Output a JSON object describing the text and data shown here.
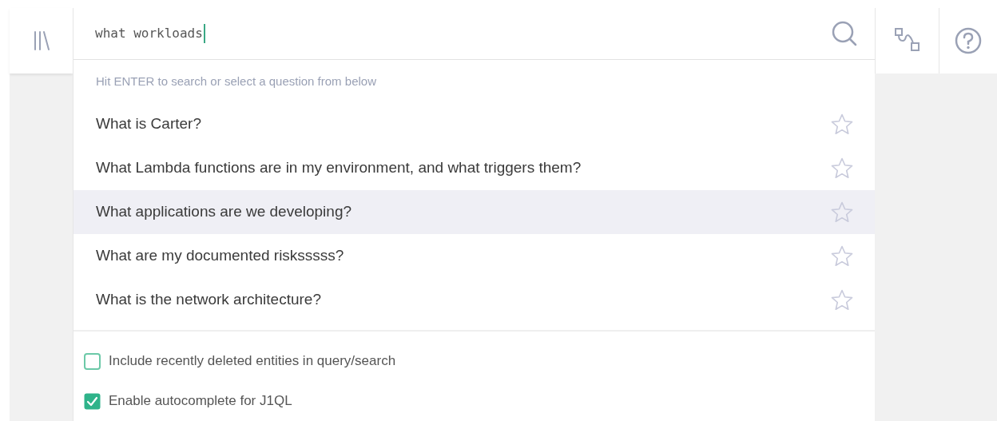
{
  "search": {
    "value": "what workloads"
  },
  "dropdown": {
    "hint": "Hit ENTER to search or select a question from below",
    "questions": [
      {
        "text": "What is Carter?",
        "selected": false,
        "starred": false
      },
      {
        "text": "What Lambda functions are in my environment, and what triggers them?",
        "selected": false,
        "starred": false
      },
      {
        "text": "What applications are we developing?",
        "selected": true,
        "starred": false
      },
      {
        "text": "What are my documented risksssss?",
        "selected": false,
        "starred": false
      },
      {
        "text": "What is the network architecture?",
        "selected": false,
        "starred": false
      }
    ],
    "options": [
      {
        "label": "Include recently deleted entities in query/search",
        "checked": false
      },
      {
        "label": "Enable autocomplete for J1QL",
        "checked": true
      }
    ]
  }
}
